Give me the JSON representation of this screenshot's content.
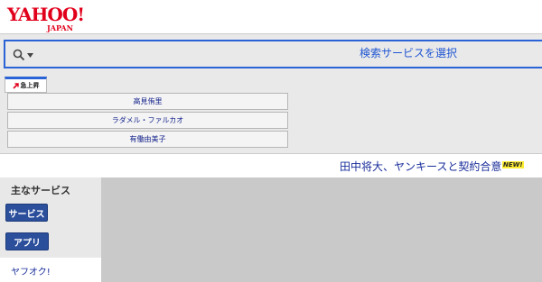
{
  "logo": {
    "main": "YAHOO!",
    "sub": "JAPAN"
  },
  "search": {
    "select_label": "検索サービスを選択"
  },
  "trending": {
    "tab_label": "急上昇",
    "items": [
      "高見侑里",
      "ラダメル・ファルカオ",
      "有働由美子"
    ]
  },
  "news": {
    "headline": "田中将大、ヤンキースと契約合意",
    "badge": "NEW!"
  },
  "sidebar": {
    "title": "主なサービス",
    "services_label": "サービス",
    "apps_label": "アプリ",
    "link": "ヤフオク!"
  },
  "colors": {
    "brand": "#e1001b",
    "accent": "#2a63d6",
    "button": "#2c4f9c"
  }
}
